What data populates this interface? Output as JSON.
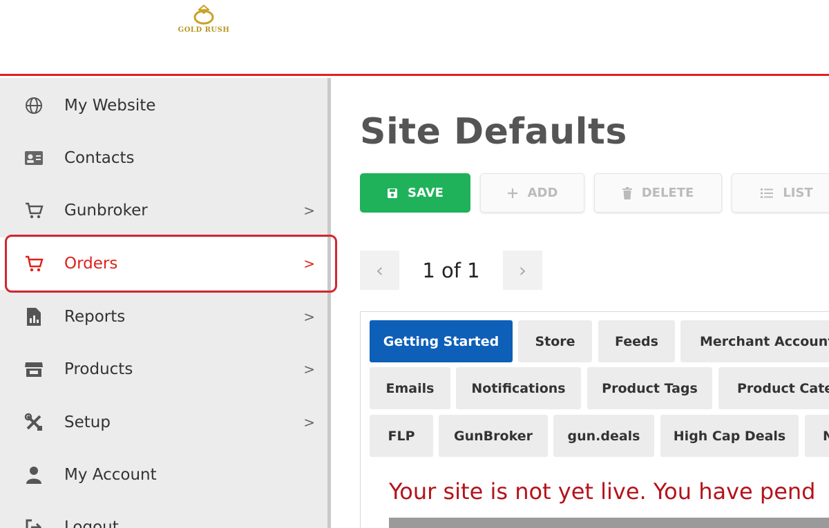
{
  "brand": {
    "name": "GOLD RUSH",
    "color": "#b8951f"
  },
  "sidebar": {
    "items": [
      {
        "label": "My Website",
        "icon": "globe-icon",
        "has_chevron": false,
        "active": false
      },
      {
        "label": "Contacts",
        "icon": "id-card-icon",
        "has_chevron": false,
        "active": false
      },
      {
        "label": "Gunbroker",
        "icon": "cart-icon",
        "has_chevron": true,
        "active": false
      },
      {
        "label": "Orders",
        "icon": "cart-icon",
        "has_chevron": true,
        "active": true
      },
      {
        "label": "Reports",
        "icon": "report-icon",
        "has_chevron": true,
        "active": false
      },
      {
        "label": "Products",
        "icon": "store-icon",
        "has_chevron": true,
        "active": false
      },
      {
        "label": "Setup",
        "icon": "tools-icon",
        "has_chevron": true,
        "active": false
      },
      {
        "label": "My Account",
        "icon": "user-icon",
        "has_chevron": false,
        "active": false
      },
      {
        "label": "Logout",
        "icon": "logout-icon",
        "has_chevron": false,
        "active": false
      }
    ],
    "chevron": ">"
  },
  "main": {
    "title": "Site Defaults",
    "toolbar": {
      "save_label": "SAVE",
      "add_label": "ADD",
      "delete_label": "DELETE",
      "list_label": "LIST"
    },
    "pager": {
      "text": "1 of 1",
      "prev": "‹",
      "next": "›"
    },
    "tabs": [
      {
        "label": "Getting Started",
        "active": true
      },
      {
        "label": "Store"
      },
      {
        "label": "Feeds"
      },
      {
        "label": "Merchant Account"
      },
      {
        "label": "Emails"
      },
      {
        "label": "Notifications"
      },
      {
        "label": "Product Tags"
      },
      {
        "label": "Product Categories"
      },
      {
        "label": "FLP"
      },
      {
        "label": "GunBroker"
      },
      {
        "label": "gun.deals"
      },
      {
        "label": "High Cap Deals"
      },
      {
        "label": "N"
      }
    ],
    "warning": "Your site is not yet live. You have pend"
  },
  "colors": {
    "accent_red": "#e0201b",
    "save_green": "#1fb25a",
    "tab_active": "#0d5fb8",
    "warning": "#b5121b"
  }
}
